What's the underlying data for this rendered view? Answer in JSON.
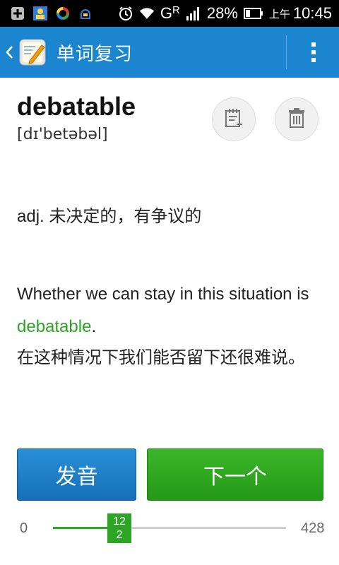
{
  "status_bar": {
    "battery": "28%",
    "am_pm": "上午",
    "time": "10:45",
    "network": "G",
    "network_sup": "R",
    "icons": [
      "add-icon",
      "contacts-icon",
      "sync-icon",
      "usb-debug-icon",
      "alarm-icon",
      "wifi-icon",
      "signal-icon",
      "battery-icon"
    ]
  },
  "app_bar": {
    "title": "单词复习",
    "back_icon": "back-chevron-icon",
    "overflow_icon": "overflow-menu-icon"
  },
  "word": {
    "headword": "debatable",
    "phonetic": "[dɪ'betəbəl]",
    "actions": [
      {
        "name": "add-to-notebook-button",
        "icon": "notebook-add-icon"
      },
      {
        "name": "delete-button",
        "icon": "trash-icon"
      }
    ],
    "definition": "adj. 未决定的，有争议的",
    "example_before": "Whether we can stay in this situation is ",
    "example_highlight": "debatable",
    "example_after": ".",
    "translation": "在这种情况下我们能否留下还很难说。"
  },
  "buttons": {
    "pronounce": "发音",
    "next": "下一个"
  },
  "progress": {
    "min": "0",
    "max": "428",
    "current": "12\n2",
    "current_line1": "12",
    "current_line2": "2",
    "value": 122,
    "total": 428
  },
  "colors": {
    "app_bar": "#1b86cf",
    "accent_green": "#2ba523",
    "button_blue": "#1b7fc7"
  }
}
